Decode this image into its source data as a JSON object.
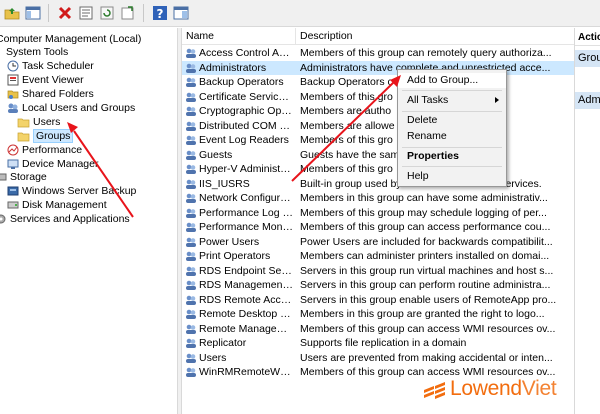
{
  "toolbar": {
    "buttons": [
      "back-icon",
      "forward-icon",
      "up-folder-icon",
      "show-hide-tree-icon",
      "delete-icon",
      "properties-icon",
      "refresh-icon",
      "export-icon",
      "help-icon",
      "mmc-view-icon"
    ]
  },
  "tree": {
    "items": [
      {
        "label": "Computer Management (Local)",
        "icon": "computer-icon"
      },
      {
        "label": "System Tools",
        "icon": "tools-icon"
      },
      {
        "label": "Task Scheduler",
        "icon": "clock-icon"
      },
      {
        "label": "Event Viewer",
        "icon": "event-viewer-icon"
      },
      {
        "label": "Shared Folders",
        "icon": "shared-folder-icon"
      },
      {
        "label": "Local Users and Groups",
        "icon": "users-icon"
      },
      {
        "label": "Users",
        "icon": "folder-icon"
      },
      {
        "label": "Groups",
        "icon": "folder-icon"
      },
      {
        "label": "Performance",
        "icon": "performance-icon"
      },
      {
        "label": "Device Manager",
        "icon": "device-manager-icon"
      },
      {
        "label": "Storage",
        "icon": "storage-icon"
      },
      {
        "label": "Windows Server Backup",
        "icon": "backup-icon"
      },
      {
        "label": "Disk Management",
        "icon": "disk-icon"
      },
      {
        "label": "Services and Applications",
        "icon": "services-icon"
      }
    ]
  },
  "list": {
    "columns": [
      "Name",
      "Description"
    ],
    "rows": [
      {
        "name": "Access Control Assist...",
        "description": "Members of this group can remotely query authoriza..."
      },
      {
        "name": "Administrators",
        "description": "Administrators have complete and unrestricted acce..."
      },
      {
        "name": "Backup Operators",
        "description": "Backup Operators c"
      },
      {
        "name": "Certificate Service DC...",
        "description": "Members of this gro"
      },
      {
        "name": "Cryptographic Operat...",
        "description": "Members are autho"
      },
      {
        "name": "Distributed COM Users",
        "description": "Members are allowe"
      },
      {
        "name": "Event Log Readers",
        "description": "Members of this gro"
      },
      {
        "name": "Guests",
        "description": "Guests have the sam"
      },
      {
        "name": "Hyper-V Administrators",
        "description": "Members of this gro"
      },
      {
        "name": "IIS_IUSRS",
        "description": "Built-in group used by Internet Information Services."
      },
      {
        "name": "Network Configuratio...",
        "description": "Members in this group can have some administrativ..."
      },
      {
        "name": "Performance Log Users",
        "description": "Members of this group may schedule logging of per..."
      },
      {
        "name": "Performance Monitor ...",
        "description": "Members of this group can access performance cou..."
      },
      {
        "name": "Power Users",
        "description": "Power Users are included for backwards compatibilit..."
      },
      {
        "name": "Print Operators",
        "description": "Members can administer printers installed on domai..."
      },
      {
        "name": "RDS Endpoint Servers",
        "description": "Servers in this group run virtual machines and host s..."
      },
      {
        "name": "RDS Management Ser...",
        "description": "Servers in this group can perform routine administra..."
      },
      {
        "name": "RDS Remote Access S...",
        "description": "Servers in this group enable users of RemoteApp pro..."
      },
      {
        "name": "Remote Desktop Users",
        "description": "Members in this group are granted the right to logo..."
      },
      {
        "name": "Remote Management...",
        "description": "Members of this group can access WMI resources ov..."
      },
      {
        "name": "Replicator",
        "description": "Supports file replication in a domain"
      },
      {
        "name": "Users",
        "description": "Users are prevented from making accidental or inten..."
      },
      {
        "name": "WinRMRemoteWMIU...",
        "description": "Members of this group can access WMI resources ov..."
      }
    ]
  },
  "actions": {
    "title": "Actio",
    "group1": "Grou",
    "group2": "Adm"
  },
  "context_menu": {
    "items": [
      "Add to Group...",
      "All Tasks",
      "Delete",
      "Rename",
      "Properties",
      "Help"
    ]
  },
  "watermark": {
    "part1": "Lowend",
    "part2": "Viet"
  },
  "colors": {
    "selection": "#cce8ff",
    "arrow": "#e8141b",
    "logo": "#f26d0f"
  }
}
